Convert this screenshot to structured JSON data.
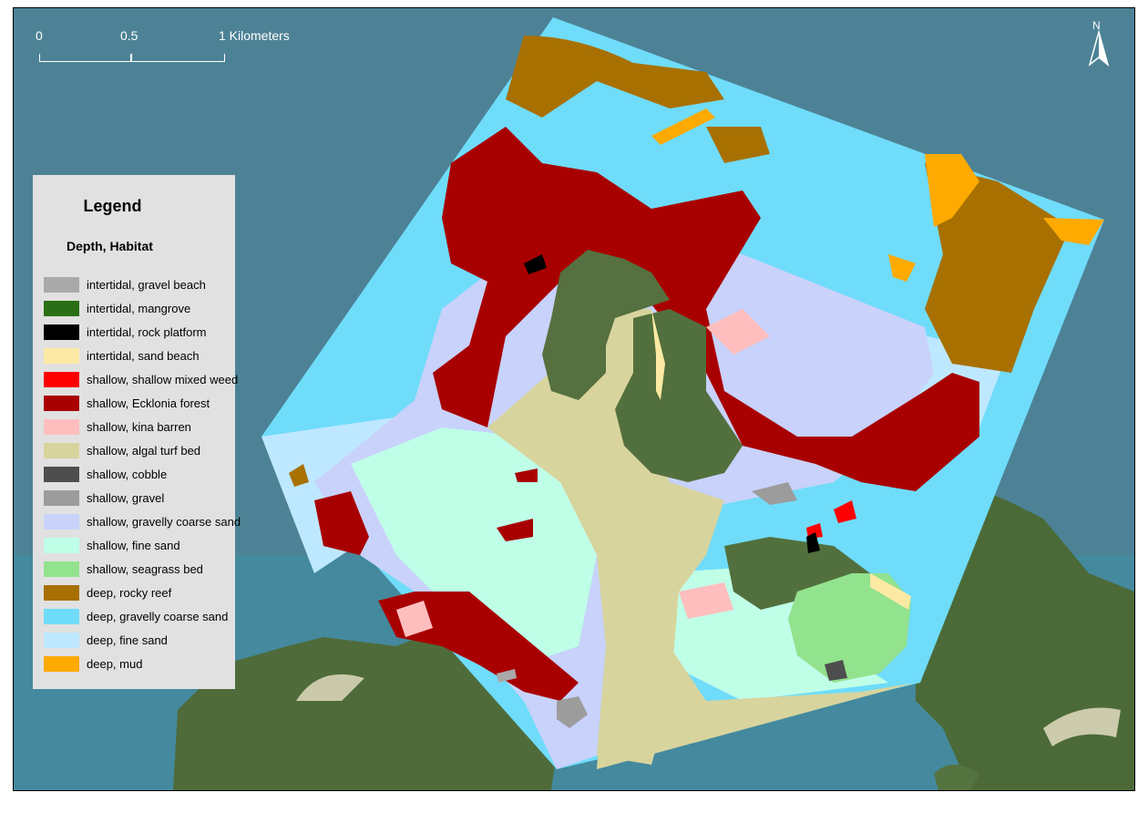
{
  "scale_bar": {
    "ticks": [
      "0",
      "0.5",
      "1 Kilometers"
    ]
  },
  "north_arrow": {
    "label": "N",
    "icon": "north-arrow-icon"
  },
  "legend": {
    "title": "Legend",
    "subtitle": "Depth, Habitat",
    "items": [
      {
        "label": "intertidal, gravel beach",
        "color": "#a9a9a9"
      },
      {
        "label": "intertidal, mangrove",
        "color": "#2a6f17"
      },
      {
        "label": "intertidal, rock platform",
        "color": "#000000"
      },
      {
        "label": "intertidal, sand beach",
        "color": "#fde9a3"
      },
      {
        "label": "shallow, shallow mixed weed",
        "color": "#ff0000"
      },
      {
        "label": "shallow, Ecklonia forest",
        "color": "#a80000"
      },
      {
        "label": "shallow, kina barren",
        "color": "#ffbebe"
      },
      {
        "label": "shallow, algal turf bed",
        "color": "#d8d49e"
      },
      {
        "label": "shallow, cobble",
        "color": "#4e4e4e"
      },
      {
        "label": "shallow, gravel",
        "color": "#9c9c9c"
      },
      {
        "label": "shallow, gravelly coarse sand",
        "color": "#c8d2fa"
      },
      {
        "label": "shallow, fine sand",
        "color": "#bfffe8"
      },
      {
        "label": "shallow, seagrass bed",
        "color": "#92e28e"
      },
      {
        "label": "deep, rocky reef",
        "color": "#a87000"
      },
      {
        "label": "deep, gravelly coarse sand",
        "color": "#6fdcfa"
      },
      {
        "label": "deep, fine sand",
        "color": "#bee8ff"
      },
      {
        "label": "deep, mud",
        "color": "#ffaa00"
      }
    ]
  },
  "colors": {
    "ocean": "#4a7f93",
    "land": "#4f6b3a",
    "legend_bg": "#e1e1e1"
  }
}
